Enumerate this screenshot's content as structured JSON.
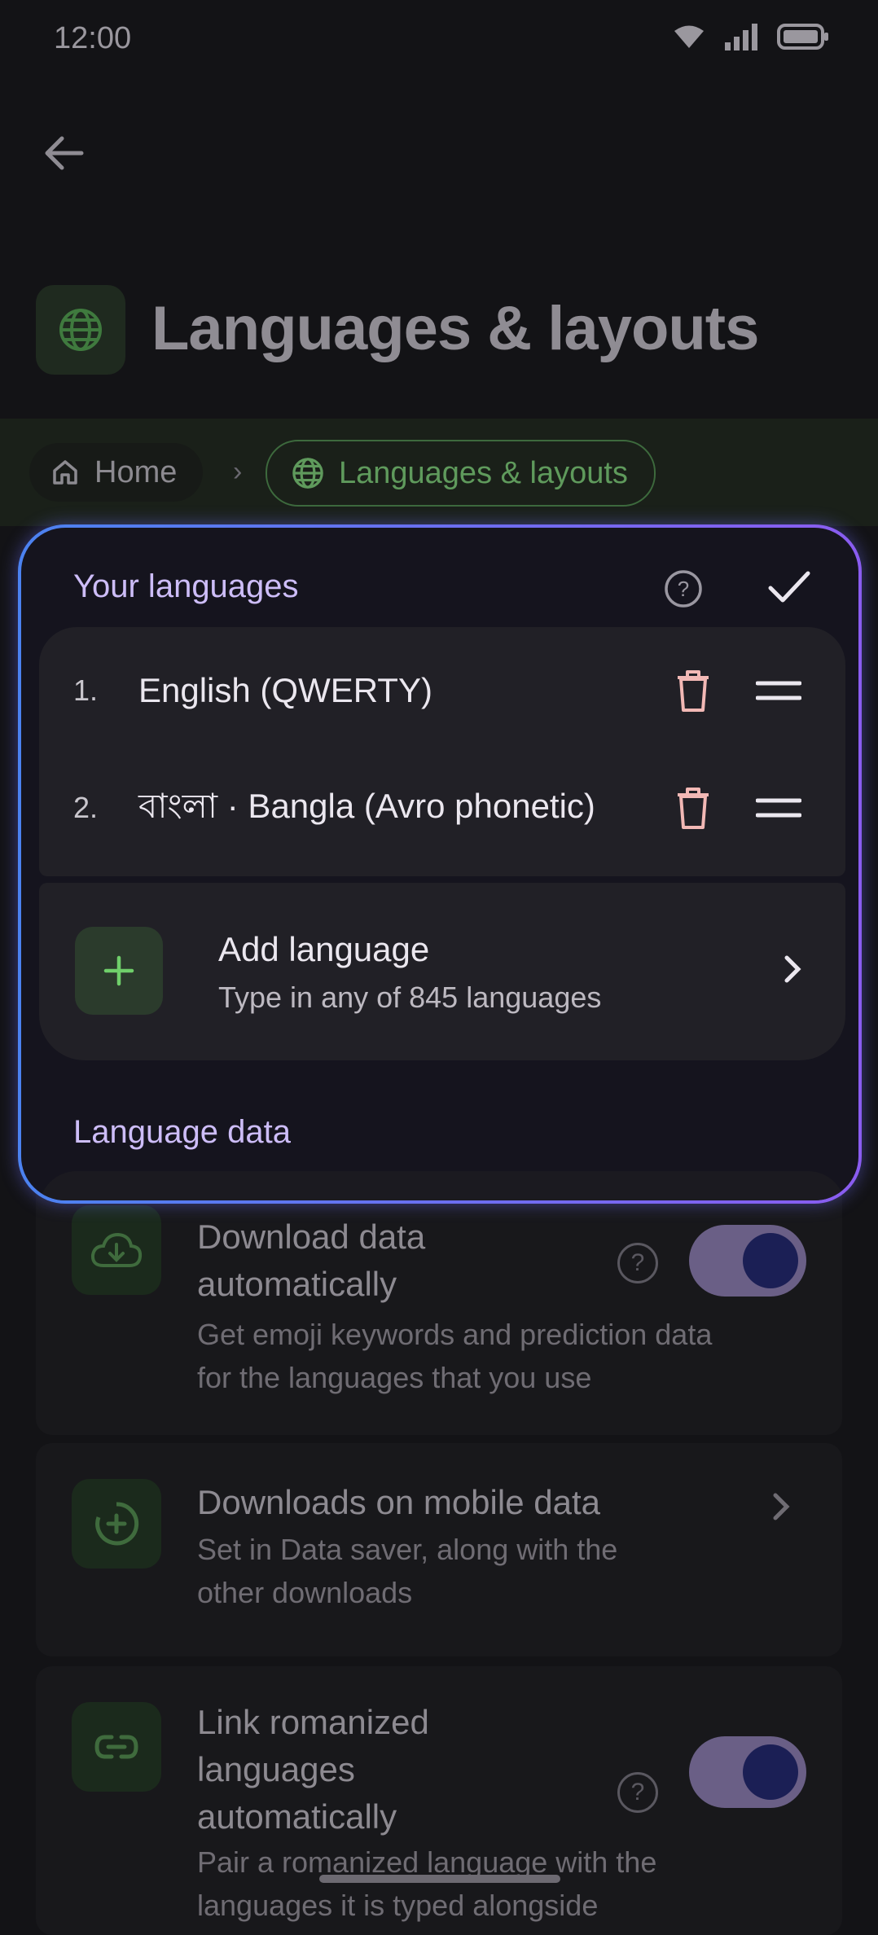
{
  "status_bar": {
    "time": "12:00"
  },
  "header": {
    "title": "Languages & layouts"
  },
  "breadcrumb": {
    "home": "Home",
    "separator": "›",
    "current": "Languages & layouts"
  },
  "your_languages": {
    "label": "Your languages",
    "items": [
      {
        "number": "1.",
        "name": "English (QWERTY)"
      },
      {
        "number": "2.",
        "name": "বাংলা · Bangla (Avro phonetic)"
      }
    ],
    "add": {
      "title": "Add language",
      "subtitle": "Type in any of 845 languages"
    }
  },
  "language_data": {
    "label": "Language data",
    "download_auto": {
      "title_line1": "Download data",
      "title_line2": "automatically",
      "subtitle_line1": "Get emoji keywords and prediction data",
      "subtitle_line2": "for the languages that you use",
      "enabled": true
    },
    "mobile_data": {
      "title": "Downloads on mobile data",
      "subtitle_line1": "Set in Data saver, along with the",
      "subtitle_line2": "other downloads"
    },
    "link_romanized": {
      "title_line1": "Link romanized",
      "title_line2": "languages",
      "title_line3": "automatically",
      "subtitle_line1": "Pair a romanized language with the",
      "subtitle_line2": "languages it is typed alongside",
      "enabled": true
    }
  },
  "colors": {
    "accent_purple": "#cdbdf8",
    "accent_green": "#5f9a5c",
    "delete_red": "#f2b8b5",
    "focus_gradient_start": "#4b82f0",
    "focus_gradient_end": "#8a5cf0"
  }
}
